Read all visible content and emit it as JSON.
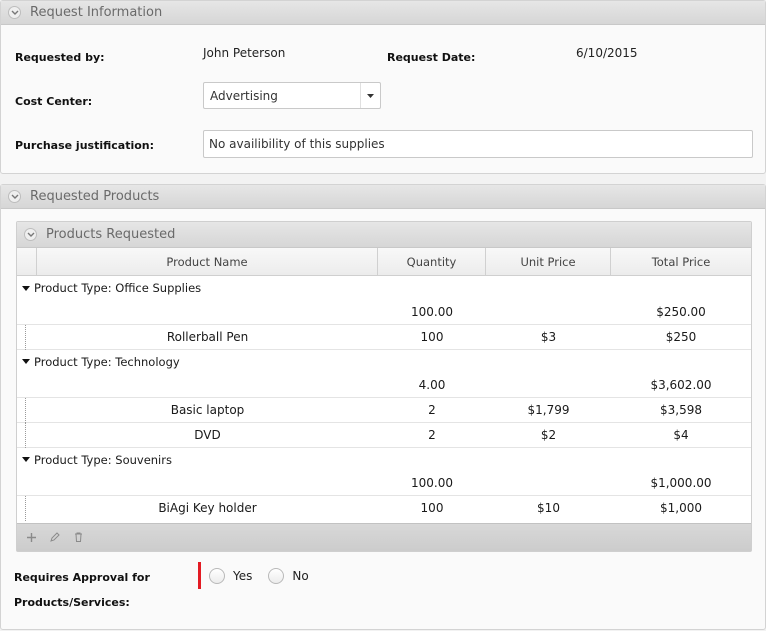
{
  "request_info": {
    "title": "Request Information",
    "requested_by_label": "Requested by:",
    "requested_by_value": "John Peterson",
    "request_date_label": "Request Date:",
    "request_date_value": "6/10/2015",
    "cost_center_label": "Cost Center:",
    "cost_center_value": "Advertising",
    "justification_label": "Purchase justification:",
    "justification_value": "No availibility of this supplies"
  },
  "requested_products": {
    "title": "Requested Products",
    "grid": {
      "title": "Products Requested",
      "columns": [
        "Product Name",
        "Quantity",
        "Unit Price",
        "Total Price"
      ],
      "groups": [
        {
          "label": "Product Type: Office Supplies",
          "sum_quantity": "100.00",
          "sum_total": "$250.00",
          "rows": [
            {
              "name": "Rollerball Pen",
              "quantity": "100",
              "unit_price": "$3",
              "total_price": "$250"
            }
          ]
        },
        {
          "label": "Product Type: Technology",
          "sum_quantity": "4.00",
          "sum_total": "$3,602.00",
          "rows": [
            {
              "name": "Basic laptop",
              "quantity": "2",
              "unit_price": "$1,799",
              "total_price": "$3,598"
            },
            {
              "name": "DVD",
              "quantity": "2",
              "unit_price": "$2",
              "total_price": "$4"
            }
          ]
        },
        {
          "label": "Product Type: Souvenirs",
          "sum_quantity": "100.00",
          "sum_total": "$1,000.00",
          "rows": [
            {
              "name": "BiAgi Key holder",
              "quantity": "100",
              "unit_price": "$10",
              "total_price": "$1,000"
            }
          ]
        }
      ],
      "footer_icons": [
        "plus-icon",
        "pencil-icon",
        "trash-icon"
      ]
    },
    "approval_label_line1": "Requires Approval for",
    "approval_label_line2": "Products/Services:",
    "approval_options": [
      "Yes",
      "No"
    ]
  },
  "colors": {
    "required_marker": "#e31b23",
    "header_text": "#6a6a6a"
  }
}
